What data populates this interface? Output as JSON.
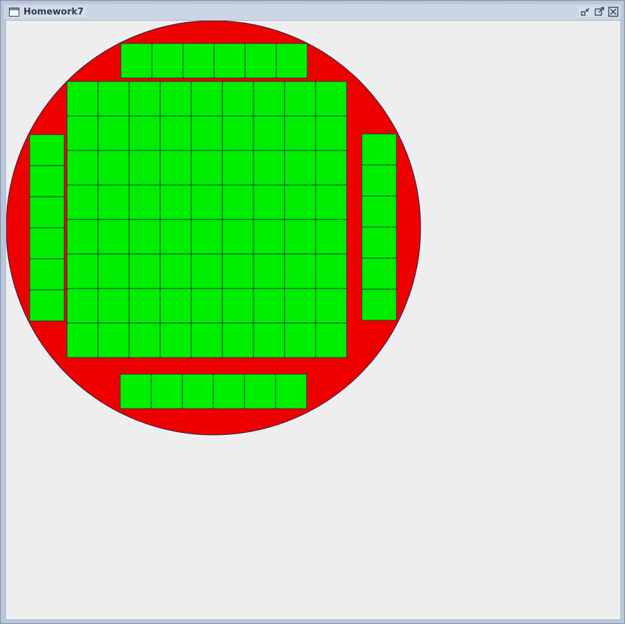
{
  "window": {
    "title": "Homework7",
    "icon": "window-icon",
    "buttons": [
      {
        "name": "minimize-button",
        "icon": "minimize-icon"
      },
      {
        "name": "maximize-button",
        "icon": "maximize-icon"
      },
      {
        "name": "close-button",
        "icon": "close-icon"
      }
    ]
  },
  "wafer": {
    "wafer_color": "#ee0000",
    "die_color": "#00ee00",
    "line_color": "#1a1a4a",
    "core_grid": {
      "rows": 8,
      "cols": 9
    },
    "top_strip": {
      "rows": 1,
      "cols": 6
    },
    "bottom_strip": {
      "rows": 1,
      "cols": 6
    },
    "left_strip": {
      "rows": 6,
      "cols": 1
    },
    "right_strip": {
      "rows": 6,
      "cols": 1
    }
  }
}
